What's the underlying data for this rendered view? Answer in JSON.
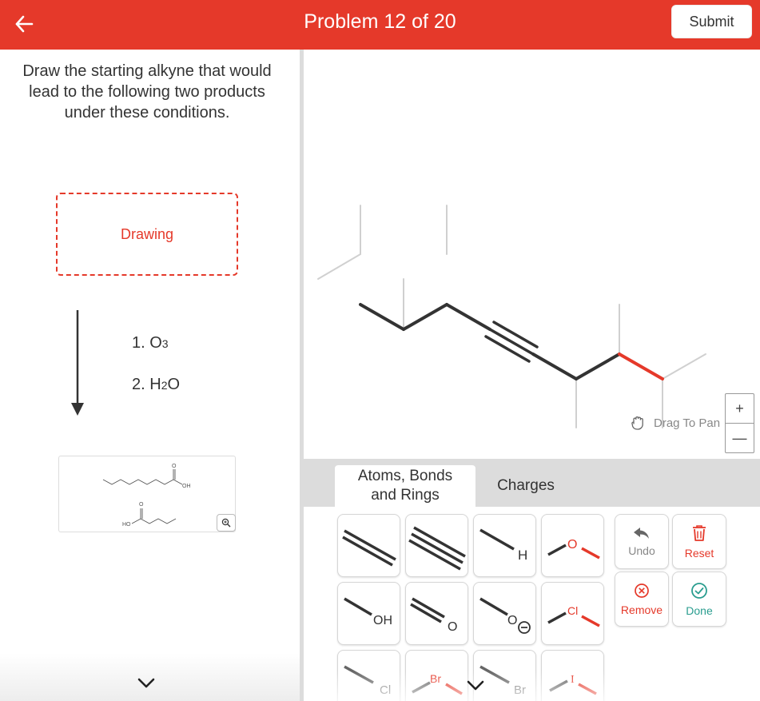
{
  "header": {
    "title": "Problem 12 of 20",
    "submit_label": "Submit",
    "back_icon": "arrow-left-icon",
    "bg_color": "#e5392a"
  },
  "question": {
    "text": "Draw the starting alkyne that would lead to the following two products under these conditions."
  },
  "drawing_box": {
    "label": "Drawing"
  },
  "conditions": {
    "step1_prefix": "1. O",
    "step1_sub": "3",
    "step2_prefix": "2. H",
    "step2_sub": "2",
    "step2_suffix": "O"
  },
  "products": {
    "label_oh": "OH",
    "label_ho": "HO",
    "label_o": "O",
    "zoom_icon": "zoom-in-icon"
  },
  "canvas": {
    "drag_label": "Drag To Pan",
    "drag_icon": "hand-icon",
    "zoom_in": "+",
    "zoom_out": "—"
  },
  "tabs": [
    {
      "label_line1": "Atoms, Bonds",
      "label_line2": "and Rings",
      "active": true
    },
    {
      "label": "Charges",
      "active": false
    }
  ],
  "tools": {
    "h_label": "H",
    "o_label": "O",
    "oh_label": "OH",
    "o_carbonyl_label": "O",
    "o_anion_label": "O",
    "cl_label": "Cl",
    "cl2_label": "Cl",
    "br_label": "Br",
    "br2_label": "Br",
    "i_label": "I"
  },
  "actions": {
    "undo": "Undo",
    "reset": "Reset",
    "remove": "Remove",
    "done": "Done"
  },
  "colors": {
    "accent": "#e5392a",
    "done": "#2a9d8f",
    "bond": "#333333",
    "ghost": "#cccccc"
  }
}
